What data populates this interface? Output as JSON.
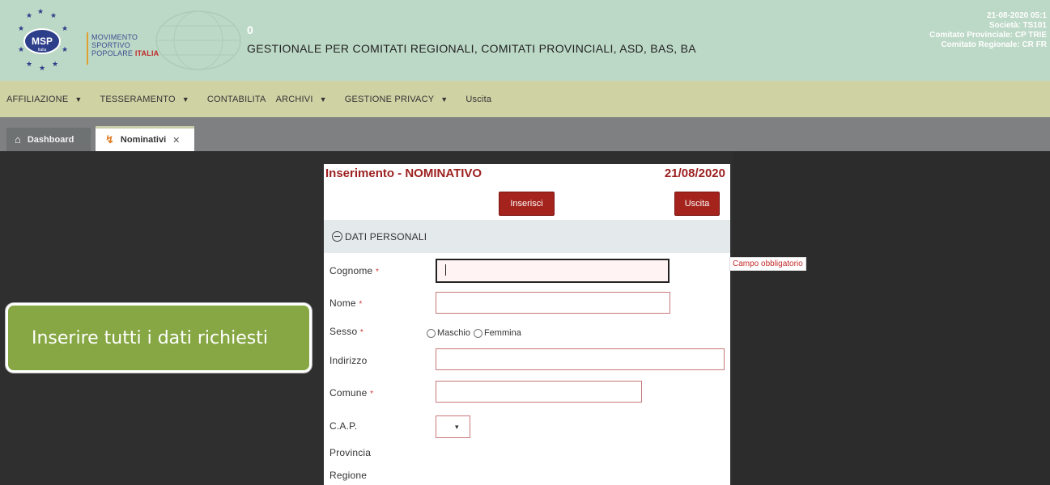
{
  "header": {
    "brand_line1": "MOVIMENTO",
    "brand_line2": "SPORTIVO",
    "brand_line3": "POPOLARE",
    "brand_line3_suffix": "ITALIA",
    "logo_text": "MSP",
    "logo_subtext": "Italia",
    "counter": "0",
    "title": "GESTIONALE PER COMITATI REGIONALI, COMITATI PROVINCIALI, ASD, BAS, BA",
    "info_datetime": "21-08-2020 05:1",
    "info_societa": "Società: TS101",
    "info_comitato_provinciale": "Comitato Provinciale: CP TRIE",
    "info_comitato_regionale": "Comitato Regionale: CR FR"
  },
  "menu": {
    "items": [
      {
        "label": "AFFILIAZIONE",
        "dropdown": true
      },
      {
        "label": "TESSERAMENTO",
        "dropdown": true
      },
      {
        "label": "CONTABILITA",
        "dropdown": false
      },
      {
        "label": "ARCHIVI",
        "dropdown": true
      },
      {
        "label": "GESTIONE PRIVACY",
        "dropdown": true
      },
      {
        "label": "Uscita",
        "dropdown": false
      }
    ]
  },
  "tabs": {
    "dashboard": "Dashboard",
    "nominativi": "Nominativi",
    "close_glyph": "✕"
  },
  "form": {
    "title": "Inserimento - NOMINATIVO",
    "date": "21/08/2020",
    "insert_label": "Inserisci",
    "exit_label": "Uscita",
    "section": "DATI PERSONALI",
    "fields": {
      "cognome": "Cognome",
      "nome": "Nome",
      "sesso": "Sesso",
      "indirizzo": "Indirizzo",
      "comune": "Comune",
      "cap": "C.A.P.",
      "provincia": "Provincia",
      "regione": "Regione"
    },
    "required_marker": "*",
    "radio_maschio": "Maschio",
    "radio_femmina": "Femmina",
    "cognome_value": "",
    "cap_value": ""
  },
  "validation_message": "Campo obbligatorio",
  "callout": "Inserire tutti i dati richiesti",
  "colors": {
    "header_bg": "#bcd8c6",
    "menu_bg": "#cfd3a4",
    "accent_red": "#a5231d",
    "callout_green": "#86a743"
  }
}
